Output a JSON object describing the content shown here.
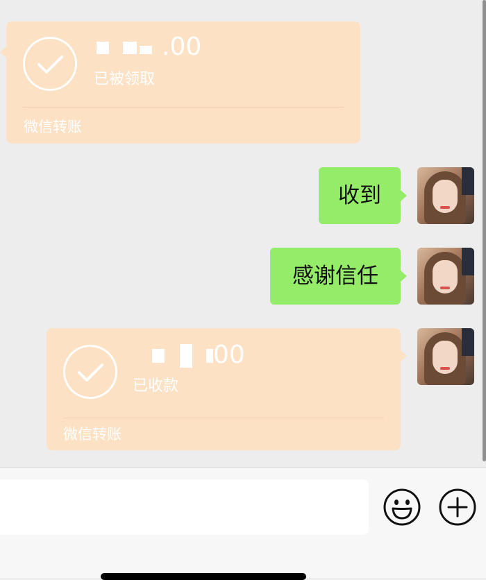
{
  "messages": {
    "transfer_received": {
      "amount_suffix": ".00",
      "status": "已被领取",
      "footer": "微信转账"
    },
    "reply_1": {
      "text": "收到"
    },
    "reply_2": {
      "text": "感谢信任"
    },
    "transfer_sent": {
      "amount_suffix": "00",
      "status": "已收款",
      "footer": "微信转账"
    }
  },
  "input_bar": {
    "message_value": "",
    "emoji_icon": "emoji-icon",
    "plus_icon": "plus-icon"
  },
  "colors": {
    "chat_background": "#ededed",
    "transfer_card": "#fde1c4",
    "my_bubble": "#95ec69",
    "input_bar": "#f7f7f7"
  }
}
